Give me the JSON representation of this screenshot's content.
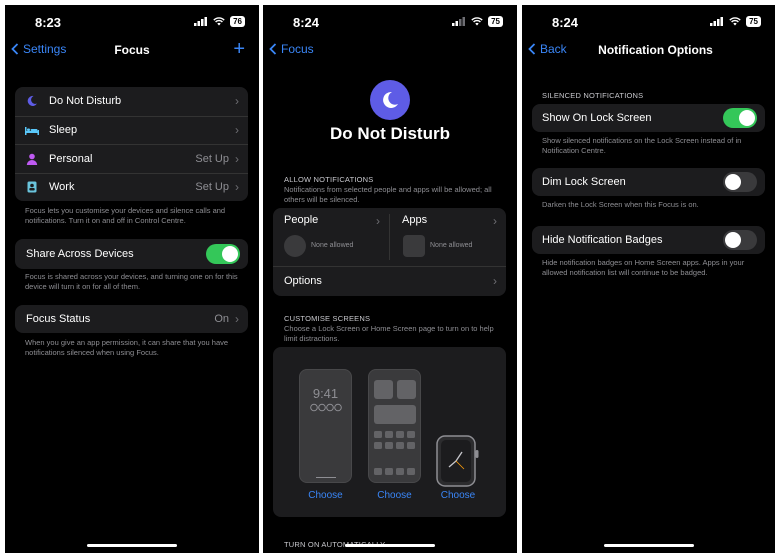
{
  "colors": {
    "accent": "#3a86f7",
    "toggle_on": "#34c759",
    "moon": "#5e5ce6",
    "sleep": "#5ac8fa",
    "personal": "#bf5af2",
    "work": "#6ac4dc"
  },
  "screen1": {
    "time": "8:23",
    "battery": "76",
    "back_label": "Settings",
    "title": "Focus",
    "focus_items": [
      {
        "label": "Do Not Disturb",
        "value": "",
        "icon": "moon-icon"
      },
      {
        "label": "Sleep",
        "value": "",
        "icon": "bed-icon"
      },
      {
        "label": "Personal",
        "value": "Set Up",
        "icon": "person-icon"
      },
      {
        "label": "Work",
        "value": "Set Up",
        "icon": "work-badge-icon"
      }
    ],
    "focus_footer": "Focus lets you customise your devices and silence calls and notifications. Turn it on and off in Control Centre.",
    "share_label": "Share Across Devices",
    "share_on": true,
    "share_footer": "Focus is shared across your devices, and turning one on for this device will turn it on for all of them.",
    "status_label": "Focus Status",
    "status_value": "On",
    "status_footer": "When you give an app permission, it can share that you have notifications silenced when using Focus."
  },
  "screen2": {
    "time": "8:24",
    "battery": "75",
    "back_label": "Focus",
    "title": "Do Not Disturb",
    "allow_header": "ALLOW NOTIFICATIONS",
    "allow_desc": "Notifications from selected people and apps will be allowed; all others will be silenced.",
    "people_label": "People",
    "people_none": "None allowed",
    "apps_label": "Apps",
    "apps_none": "None allowed",
    "options_label": "Options",
    "customise_header": "CUSTOMISE SCREENS",
    "customise_desc": "Choose a Lock Screen or Home Screen page to turn on to help limit distractions.",
    "lock_time": "9:41",
    "choose_labels": [
      "Choose",
      "Choose",
      "Choose"
    ],
    "auto_header": "TURN ON AUTOMATICALLY"
  },
  "screen3": {
    "time": "8:24",
    "battery": "75",
    "back_label": "Back",
    "title": "Notification Options",
    "silenced_header": "SILENCED NOTIFICATIONS",
    "show_lock_label": "Show On Lock Screen",
    "show_lock_on": true,
    "show_lock_desc": "Show silenced notifications on the Lock Screen instead of in Notification Centre.",
    "dim_label": "Dim Lock Screen",
    "dim_on": false,
    "dim_desc": "Darken the Lock Screen when this Focus is on.",
    "badges_label": "Hide Notification Badges",
    "badges_on": false,
    "badges_desc": "Hide notification badges on Home Screen apps. Apps in your allowed notification list will continue to be badged."
  }
}
